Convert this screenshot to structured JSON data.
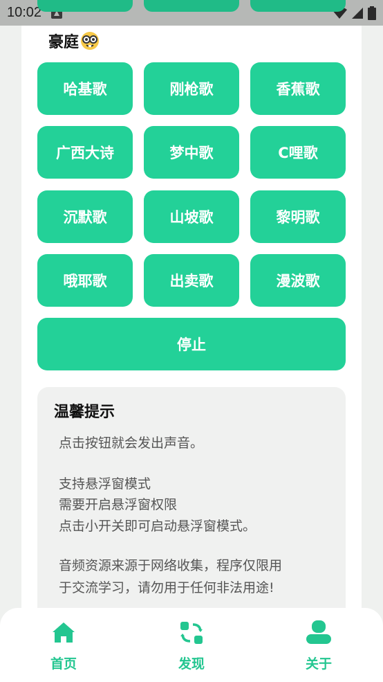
{
  "status_bar": {
    "time": "10:02"
  },
  "section": {
    "title": "豪庭",
    "emoji_icon": "nerd-face-emoji"
  },
  "buttons": [
    "哈基歌",
    "刚枪歌",
    "香蕉歌",
    "广西大诗",
    "梦中歌",
    "C哩歌",
    "沉默歌",
    "山坡歌",
    "黎明歌",
    "哦耶歌",
    "出卖歌",
    "漫波歌"
  ],
  "stop_label": "停止",
  "tips": {
    "title": "温馨提示",
    "lines": [
      "点击按钮就会发出声音。",
      "支持悬浮窗模式",
      "需要开启悬浮窗权限",
      "点击小开关即可启动悬浮窗模式。",
      "音频资源来源于网络收集，程序仅限用",
      "于交流学习，请勿用于任何非法用途!"
    ]
  },
  "nav": {
    "items": [
      {
        "label": "首页",
        "icon": "home-icon"
      },
      {
        "label": "发现",
        "icon": "discover-icon"
      },
      {
        "label": "关于",
        "icon": "user-icon"
      }
    ]
  },
  "colors": {
    "accent": "#23d198",
    "nav_label": "#23c690",
    "status_bar": "#b6b8b6"
  }
}
